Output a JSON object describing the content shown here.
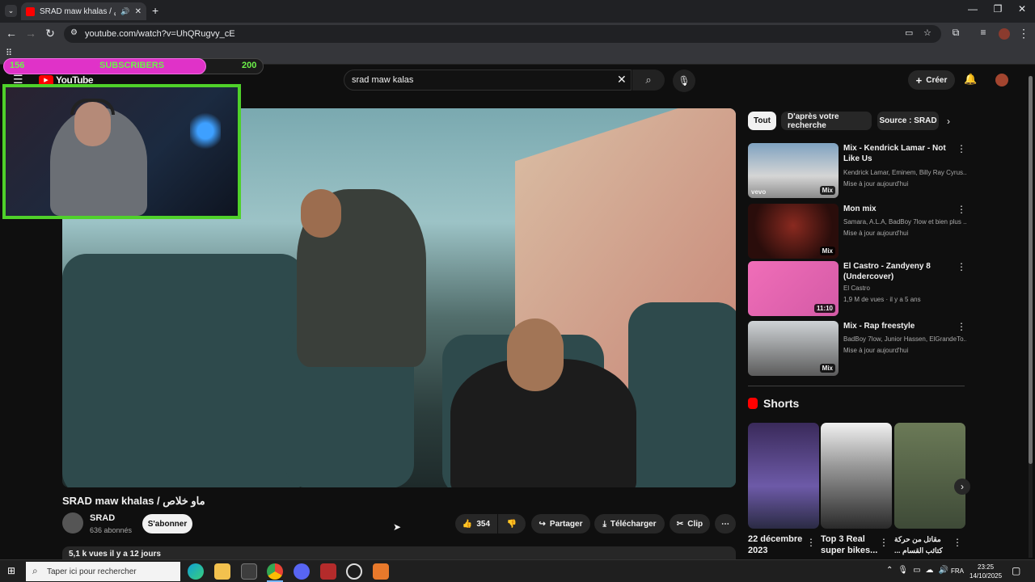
{
  "browser": {
    "tab_title": "SRAD maw khalas / ماو خلاص",
    "url": "youtube.com/watch?v=UhQRugvy_cE"
  },
  "overlay": {
    "sub_current": "156",
    "sub_label": "SUBSCRIBERS",
    "sub_goal": "200",
    "sub_progress": 0.78
  },
  "youtube": {
    "logo": "YouTube",
    "search_value": "srad maw kalas",
    "create_label": "Créer",
    "video_title": "SRAD maw khalas / ماو خلاص",
    "channel_name": "SRAD",
    "channel_subs": "636 abonnés",
    "subscribe_label": "S'abonner",
    "likes": "354",
    "share_label": "Partager",
    "download_label": "Télécharger",
    "clip_label": "Clip",
    "views_date": "5,1 k vues  il y a 12 jours",
    "chips": [
      "Tout",
      "D'après votre recherche",
      "Source : SRAD"
    ],
    "recommendations": [
      {
        "title": "Mix - Kendrick Lamar - Not Like Us",
        "line1": "Kendrick Lamar, Eminem, Billy Ray Cyrus...",
        "line2": "Mise à jour aujourd'hui",
        "badge": "Mix",
        "brand": "vevo"
      },
      {
        "title": "Mon mix",
        "line1": "Samara, A.L.A, BadBoy 7low et bien plus ...",
        "line2": "Mise à jour aujourd'hui",
        "badge": "Mix"
      },
      {
        "title": "El Castro -  Zandyeny 8 (Undercover)",
        "line1": "El Castro",
        "line2": "1,9 M de vues · il y a 5 ans",
        "badge": "11:10"
      },
      {
        "title": "Mix - Rap freestyle",
        "line1": "BadBoy 7low, Junior Hassen, ElGrandeTo...",
        "line2": "Mise à jour aujourd'hui",
        "badge": "Mix"
      }
    ],
    "shorts_title": "Shorts",
    "shorts": [
      "22 décembre 2023",
      "Top 3 Real super bikes...",
      "مقاتل من حركة كتائب القسام ..."
    ]
  },
  "taskbar": {
    "search_placeholder": "Taper ici pour rechercher",
    "lang": "FRA",
    "time": "23:25",
    "date": "14/10/2025"
  },
  "colors": {
    "accent_red": "#ff0000",
    "overlay_pink": "#e032c8",
    "overlay_green": "#4fd12a"
  }
}
